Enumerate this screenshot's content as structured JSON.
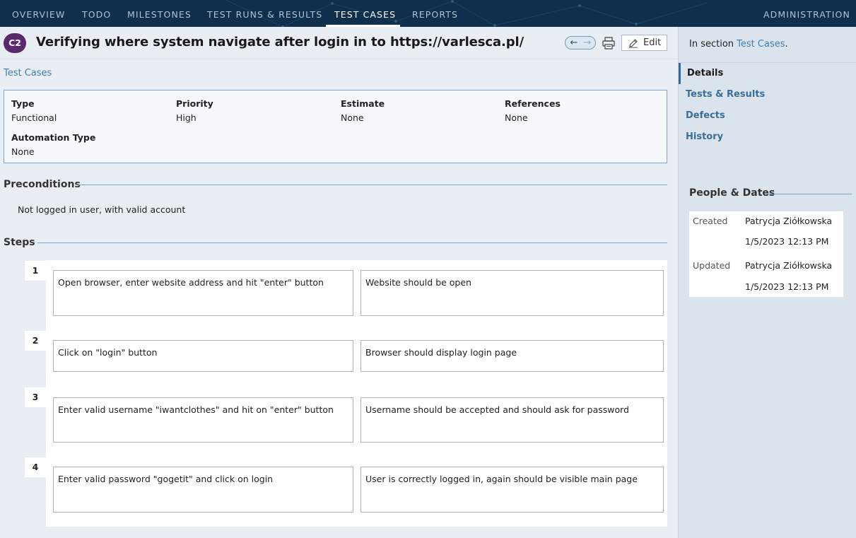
{
  "topnav": {
    "items": [
      {
        "label": "OVERVIEW"
      },
      {
        "label": "TODO"
      },
      {
        "label": "MILESTONES"
      },
      {
        "label": "TEST RUNS & RESULTS"
      },
      {
        "label": "TEST CASES"
      },
      {
        "label": "REPORTS"
      }
    ],
    "admin_label": "ADMINISTRATION",
    "active": "TEST CASES"
  },
  "header": {
    "case_id": "C2",
    "title": "Verifying where system navigate after login in to https://varlesca.pl/",
    "edit_label": "Edit",
    "nav_prev_icon": "arrow-left-icon",
    "nav_next_icon": "arrow-right-icon",
    "print_icon": "printer-icon",
    "edit_icon": "pencil-icon"
  },
  "breadcrumb": "Test Cases",
  "fields": {
    "type": {
      "label": "Type",
      "value": "Functional"
    },
    "priority": {
      "label": "Priority",
      "value": "High"
    },
    "estimate": {
      "label": "Estimate",
      "value": "None"
    },
    "references": {
      "label": "References",
      "value": "None"
    },
    "automation_type": {
      "label": "Automation Type",
      "value": "None"
    }
  },
  "preconditions": {
    "heading": "Preconditions",
    "text": "Not logged in user, with valid account"
  },
  "steps": {
    "heading": "Steps",
    "items": [
      {
        "num": "1",
        "action": "Open browser, enter website address and hit \"enter\" button",
        "expected": "Website should be open"
      },
      {
        "num": "2",
        "action": "Click on \"login\" button",
        "expected": "Browser should display login page"
      },
      {
        "num": "3",
        "action": "Enter valid username \"iwantclothes\" and hit on \"enter\" button",
        "expected": "Username should be accepted and should ask for password"
      },
      {
        "num": "4",
        "action": "Enter valid password \"gogetit\" and click on login",
        "expected": "User is correctly logged in, again should be visible main page"
      }
    ]
  },
  "sidebar": {
    "section_prefix": "In section ",
    "section_link": "Test Cases",
    "section_suffix": ".",
    "tabs": [
      {
        "label": "Details"
      },
      {
        "label": "Tests & Results"
      },
      {
        "label": "Defects"
      },
      {
        "label": "History"
      }
    ],
    "active_tab": "Details",
    "people_heading": "People & Dates",
    "created_label": "Created",
    "created_by": "Patrycja Ziółkowska",
    "created_at": "1/5/2023 12:13 PM",
    "updated_label": "Updated",
    "updated_by": "Patrycja Ziółkowska",
    "updated_at": "1/5/2023 12:13 PM"
  },
  "colors": {
    "nav_bg": "#0f2f4c",
    "badge_bg": "#5b2a6e",
    "link": "#3d7eb6",
    "accent_line": "#7aa7cb"
  }
}
